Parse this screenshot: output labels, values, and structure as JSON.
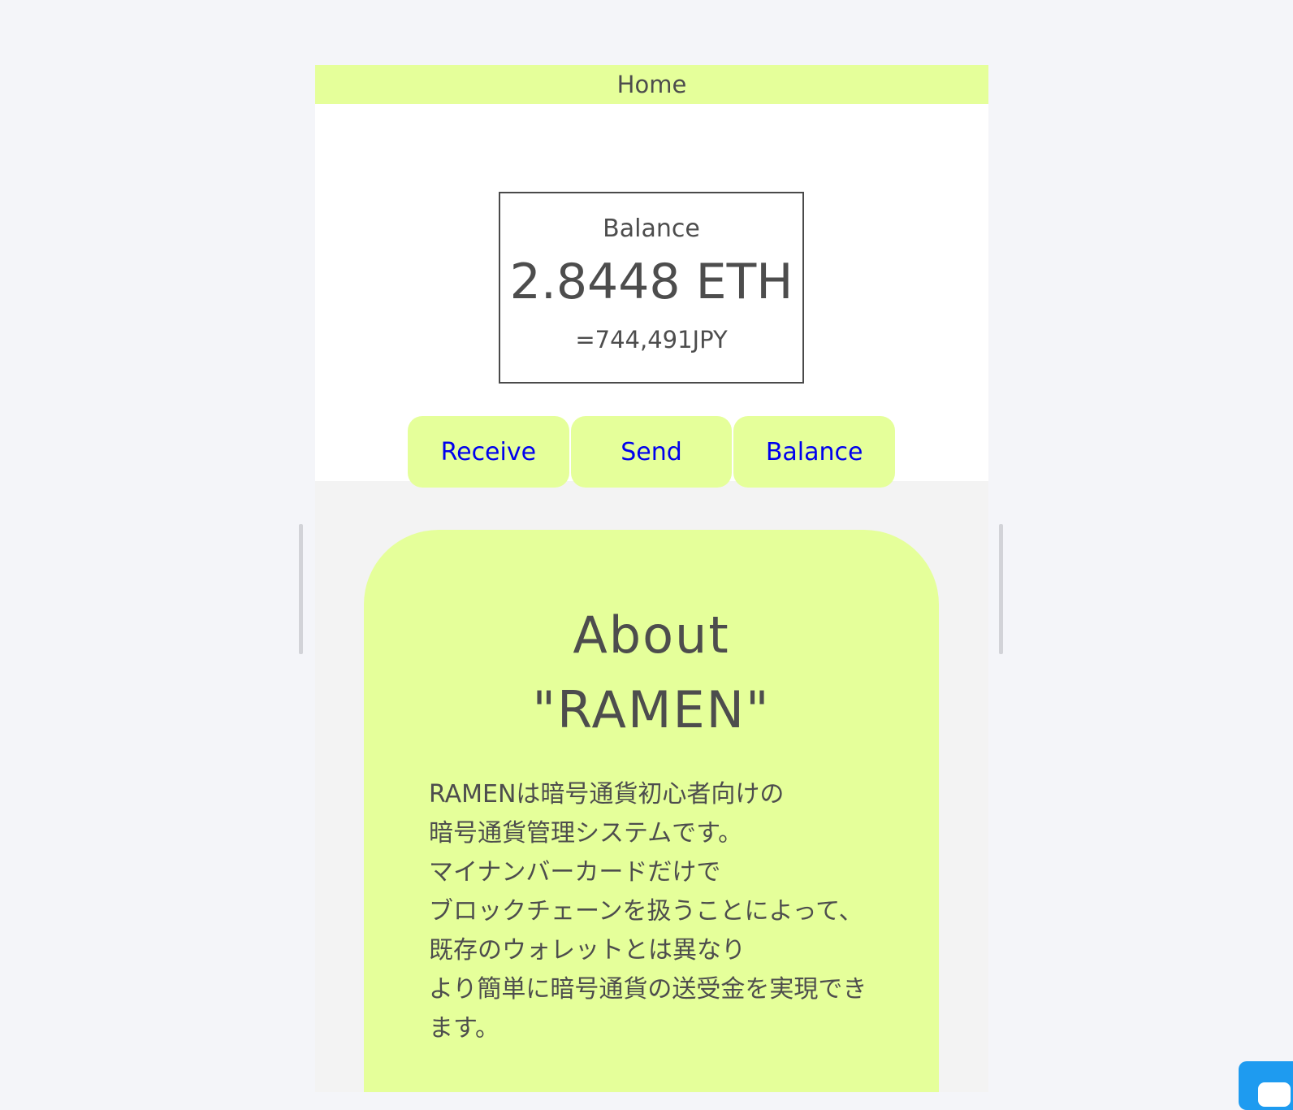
{
  "header": {
    "title": "Home"
  },
  "balance": {
    "label": "Balance",
    "amount": "2.8448 ETH",
    "fiat": "=744,491JPY"
  },
  "actions": [
    {
      "label": "Receive"
    },
    {
      "label": "Send"
    },
    {
      "label": "Balance"
    }
  ],
  "about": {
    "title_line1": "About",
    "title_line2": "\"RAMEN\"",
    "body": "RAMENは暗号通貨初心者向けの\n暗号通貨管理システムです。\nマイナンバーカードだけで\nブロックチェーンを扱うことによって、\n既存のウォレットとは異なり\nより簡単に暗号通貨の送受金を実現できます。"
  },
  "colors": {
    "accent": "#e5ff9a",
    "link": "#0000ee",
    "text": "#4d4d4d",
    "chat_widget": "#1e9bf0"
  },
  "icons": {
    "chat": "chat-icon"
  }
}
